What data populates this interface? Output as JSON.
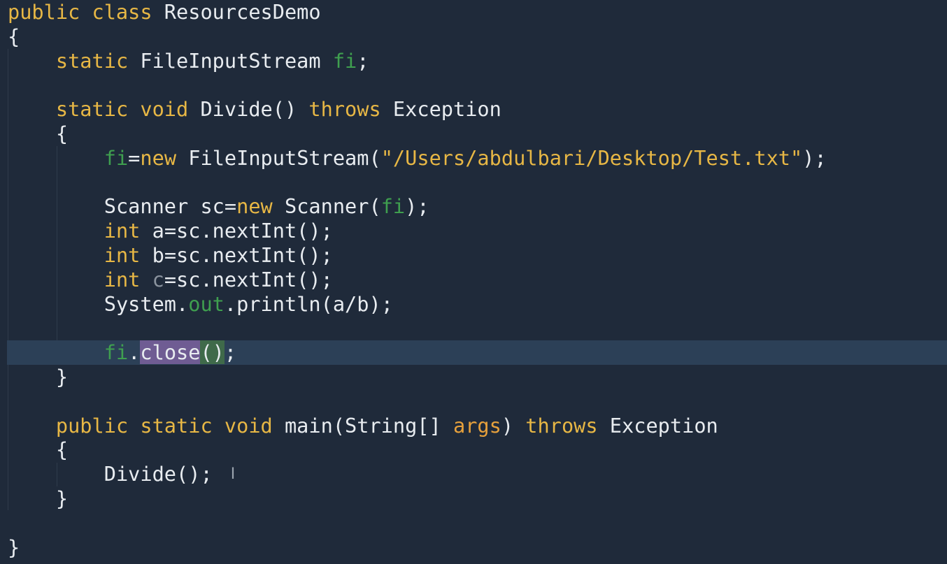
{
  "editor": {
    "language": "java",
    "colors": {
      "background": "#1f2a3a",
      "keyword": "#e7b745",
      "field": "#3f9f4f",
      "string": "#e7b745",
      "current_line": "#2c4057",
      "selection": "#6f5c93"
    },
    "code": {
      "l1_kw": "public class",
      "l1_name": " ResourcesDemo",
      "l2": "{",
      "l3_kw": "static",
      "l3_type": " FileInputStream ",
      "l3_field": "fi",
      "l3_end": ";",
      "l5_kw1": "static void",
      "l5_name": " Divide() ",
      "l5_kw2": "throws",
      "l5_exc": " Exception",
      "l6": "{",
      "l7_field": "fi",
      "l7_eq": "=",
      "l7_new": "new",
      "l7_type": " FileInputStream(",
      "l7_str": "\"/Users/abdulbari/Desktop/Test.txt\"",
      "l7_end": ");",
      "l9_a": "Scanner sc=",
      "l9_new": "new",
      "l9_b": " Scanner(",
      "l9_field": "fi",
      "l9_end": ");",
      "l10_kw": "int",
      "l10_rest": " a=sc.nextInt();",
      "l11_kw": "int",
      "l11_rest": " b=sc.nextInt();",
      "l12_kw": "int",
      "l12_sp": " ",
      "l12_var": "c",
      "l12_rest": "=sc.nextInt();",
      "l13_a": "System.",
      "l13_field": "out",
      "l13_b": ".println(a/b);",
      "l15_field": "fi",
      "l15_dot": ".",
      "l15_method": "close",
      "l15_parens": "()",
      "l15_end": ";",
      "l16": "}",
      "l18_kw": "public static void",
      "l18_name": " main(String[] ",
      "l18_param": "args",
      "l18_paren": ") ",
      "l18_kw2": "throws",
      "l18_exc": " Exception",
      "l19": "{",
      "l20": "Divide();",
      "l20_cursor": "I",
      "l21": "}",
      "l23": "}"
    }
  }
}
